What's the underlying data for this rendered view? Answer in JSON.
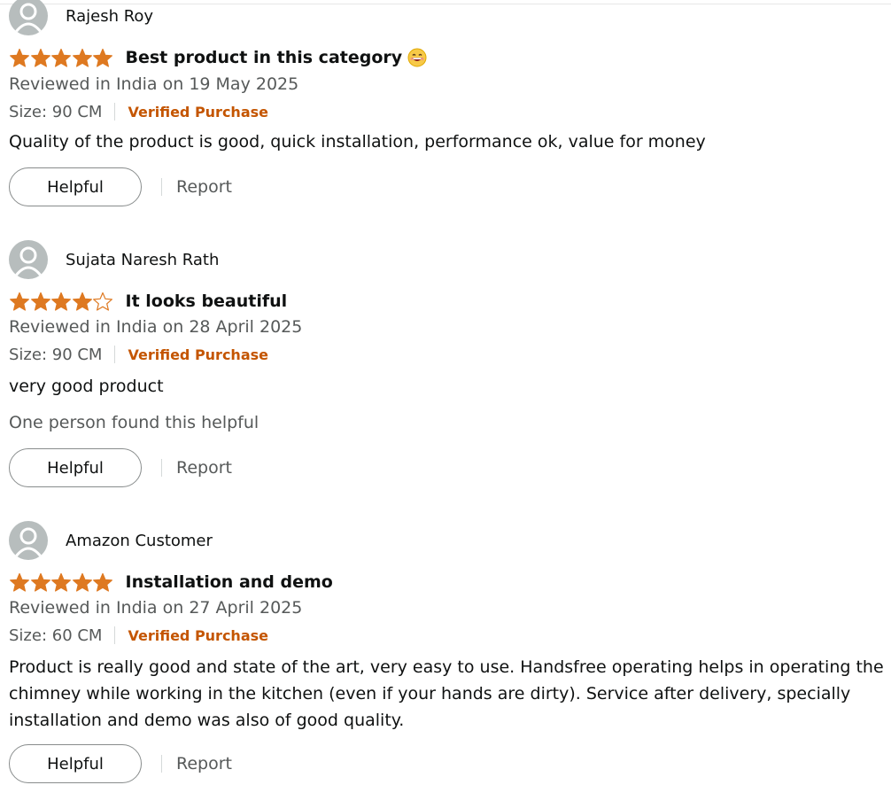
{
  "colors": {
    "star": "#de7921",
    "verified": "#c45500",
    "secondary_text": "#565959",
    "avatar_bg": "#b7bdbd"
  },
  "icons": {
    "avatar": "default-user-avatar-icon",
    "star_full": "star-filled-icon",
    "star_empty": "star-outline-icon",
    "emoji": "grinning-face-emoji-icon"
  },
  "reviews": [
    {
      "reviewer": "Rajesh Roy",
      "rating": 5,
      "max_rating": 5,
      "title": "Best product in this category",
      "title_emoji": "😁",
      "date": "Reviewed in India on 19 May 2025",
      "size": "Size: 90 CM",
      "verified": "Verified Purchase",
      "body": "Quality of the product is good, quick installation, performance ok, value for money",
      "helpful_count_text": "",
      "helpful_label": "Helpful",
      "report_label": "Report"
    },
    {
      "reviewer": "Sujata Naresh Rath",
      "rating": 4,
      "max_rating": 5,
      "title": "It looks beautiful",
      "date": "Reviewed in India on 28 April 2025",
      "size": "Size: 90 CM",
      "verified": "Verified Purchase",
      "body": "very good product",
      "helpful_count_text": "One person found this helpful",
      "helpful_label": "Helpful",
      "report_label": "Report"
    },
    {
      "reviewer": "Amazon Customer",
      "rating": 5,
      "max_rating": 5,
      "title": "Installation and demo",
      "date": "Reviewed in India on 27 April 2025",
      "size": "Size: 60 CM",
      "verified": "Verified Purchase",
      "body": "Product is really good and state of the art, very easy to use. Handsfree operating helps in operating the chimney while working in the kitchen (even if your hands are dirty). Service after delivery, specially installation and demo was also of good quality.",
      "helpful_count_text": "",
      "helpful_label": "Helpful",
      "report_label": "Report"
    }
  ]
}
